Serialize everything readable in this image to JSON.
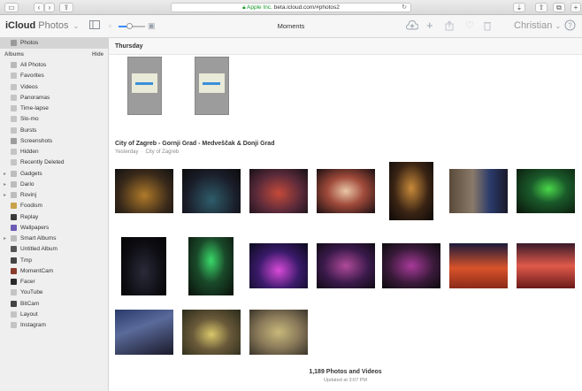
{
  "browser": {
    "url_org": "Apple Inc.",
    "url": "beta.icloud.com/#photos2"
  },
  "toolbar": {
    "brand_bold": "iCloud",
    "brand_light": "Photos",
    "view_title": "Moments",
    "user_name": "Christian",
    "zoom_level": 0.4
  },
  "sidebar": {
    "top_item": "Photos",
    "albums_header": "Albums",
    "hide_label": "Hide",
    "items": [
      {
        "label": "All Photos",
        "icon": "all-photos-icon",
        "color": "#b9b9b9"
      },
      {
        "label": "Favorites",
        "icon": "heart-icon",
        "color": "#c4c4c4"
      },
      {
        "label": "Videos",
        "icon": "video-icon",
        "color": "#c4c4c4"
      },
      {
        "label": "Panoramas",
        "icon": "panorama-icon",
        "color": "#c4c4c4"
      },
      {
        "label": "Time-lapse",
        "icon": "timelapse-icon",
        "color": "#c4c4c4"
      },
      {
        "label": "Slo-mo",
        "icon": "slomo-icon",
        "color": "#c4c4c4"
      },
      {
        "label": "Bursts",
        "icon": "bursts-icon",
        "color": "#c4c4c4"
      },
      {
        "label": "Screenshots",
        "icon": "screenshots-icon",
        "color": "#9c9c9c"
      },
      {
        "label": "Hidden",
        "icon": "hidden-icon",
        "color": "#c4c4c4"
      },
      {
        "label": "Recently Deleted",
        "icon": "trash-icon",
        "color": "#c4c4c4"
      },
      {
        "label": "Gadgets",
        "icon": "folder-icon",
        "color": "#bdbdbd",
        "expandable": true
      },
      {
        "label": "Dario",
        "icon": "folder-icon",
        "color": "#bdbdbd",
        "expandable": true
      },
      {
        "label": "Rovinj",
        "icon": "folder-icon",
        "color": "#bdbdbd",
        "expandable": true
      },
      {
        "label": "Foodism",
        "icon": "album-thumb-icon",
        "color": "#c9a24a"
      },
      {
        "label": "Replay",
        "icon": "album-thumb-icon",
        "color": "#3a3a3a"
      },
      {
        "label": "Wallpapers",
        "icon": "album-thumb-icon",
        "color": "#6d5bb5"
      },
      {
        "label": "Smart Albums",
        "icon": "folder-icon",
        "color": "#bdbdbd",
        "expandable": true
      },
      {
        "label": "Untitled Album",
        "icon": "album-thumb-icon",
        "color": "#555555"
      },
      {
        "label": "Tmp",
        "icon": "album-thumb-icon",
        "color": "#444444"
      },
      {
        "label": "MomentCam",
        "icon": "album-thumb-icon",
        "color": "#8a3b2b"
      },
      {
        "label": "Facer",
        "icon": "album-thumb-icon",
        "color": "#2a2a2a"
      },
      {
        "label": "YouTube",
        "icon": "album-icon",
        "color": "#c4c4c4"
      },
      {
        "label": "BitCam",
        "icon": "album-thumb-icon",
        "color": "#444444"
      },
      {
        "label": "Layout",
        "icon": "album-icon",
        "color": "#c4c4c4"
      },
      {
        "label": "Instagram",
        "icon": "album-icon",
        "color": "#c4c4c4"
      }
    ]
  },
  "main": {
    "section1_title": "Thursday",
    "section2_title": "City of Zagreb - Gornji Grad - Medveščak & Donji Grad",
    "section2_date": "Yesterday",
    "section2_place": "City of Zagreb",
    "photos_count": "1,189 Photos and Videos",
    "updated": "Updated at 3:07 PM"
  }
}
